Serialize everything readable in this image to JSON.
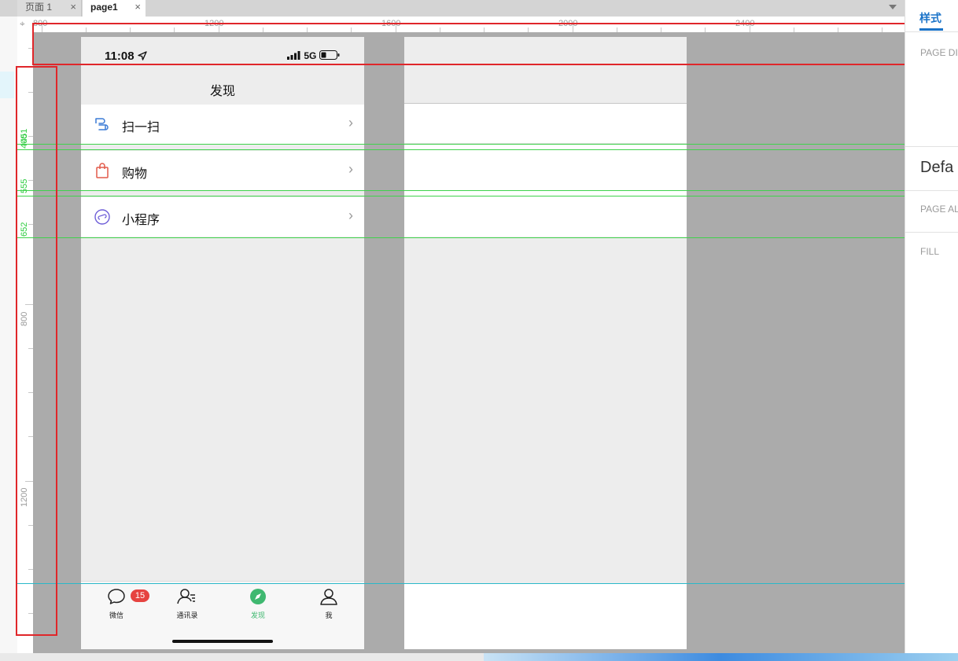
{
  "tabs": [
    {
      "label": "页面 1",
      "close": "×"
    },
    {
      "label": "page1",
      "close": "×"
    }
  ],
  "ruler": {
    "h_labels": [
      "800",
      "1200",
      "1600",
      "2000",
      "2400"
    ],
    "v_labels": [
      "800",
      "1200"
    ],
    "guide_labels": [
      "400",
      "451",
      "555",
      "652"
    ]
  },
  "phone": {
    "status_time": "11:08",
    "status_network": "5G",
    "nav_title": "发现",
    "menu": [
      {
        "label": "扫一扫",
        "icon": "scan-icon",
        "chevron": "›"
      },
      {
        "label": "购物",
        "icon": "shopping-bag-icon",
        "chevron": "›"
      },
      {
        "label": "小程序",
        "icon": "mini-program-icon",
        "chevron": "›"
      }
    ],
    "bottom_tabs": [
      {
        "label": "微信",
        "icon": "chat-icon",
        "badge": "15"
      },
      {
        "label": "通讯录",
        "icon": "contacts-icon"
      },
      {
        "label": "发现",
        "icon": "discover-icon",
        "active": true
      },
      {
        "label": "我",
        "icon": "me-icon"
      }
    ]
  },
  "right_panel": {
    "tab_label": "样式",
    "page_dimensions_label": "PAGE DI",
    "default_label": "Defa",
    "page_align_label": "PAGE AL",
    "fill_label": "FILL"
  },
  "colors": {
    "canvas": "#ababab",
    "guide_green": "#3fd24b",
    "guide_cyan": "#2ab8c9",
    "highlight_red": "#e0262a",
    "wechat_green": "#3fb870",
    "badge_red": "#e64340",
    "accent_blue": "#1a73c8"
  }
}
